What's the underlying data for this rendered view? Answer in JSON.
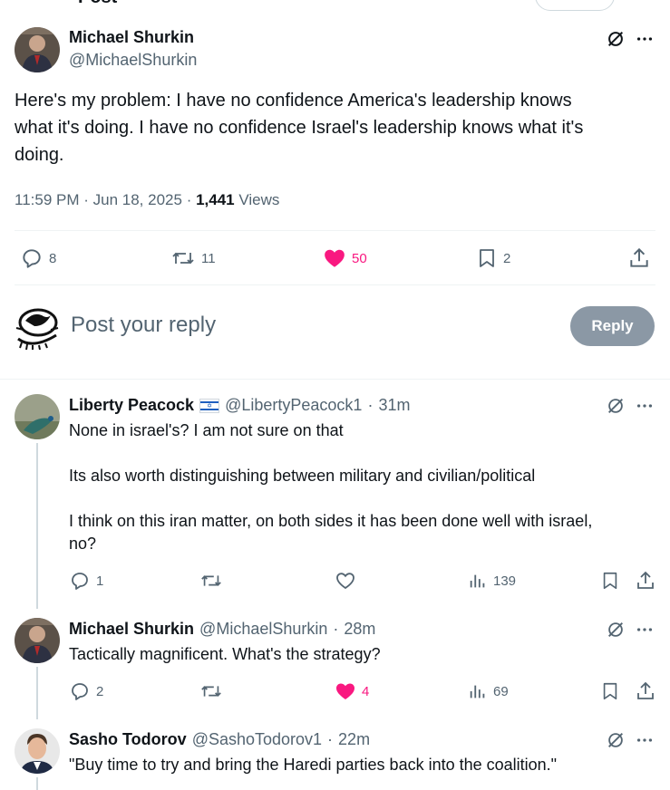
{
  "header": {
    "title": "Post",
    "reply_pill_label": "Reply"
  },
  "main_post": {
    "author_name": "Michael Shurkin",
    "author_handle": "@MichaelShurkin",
    "text_line1": "Here's my problem: I have no confidence America's leadership knows",
    "text_line2": "what it's doing. I have no confidence Israel's leadership knows what it's",
    "text_line3": "doing.",
    "time": "11:59 PM",
    "date": "Jun 18, 2025",
    "views_count": "1,441",
    "views_label": "Views",
    "replies": "8",
    "reposts": "11",
    "likes": "50",
    "bookmarks": "2"
  },
  "composer": {
    "placeholder": "Post your reply",
    "button_label": "Reply"
  },
  "replies": [
    {
      "author_name": "Liberty Peacock",
      "author_handle": "@LibertyPeacock1",
      "time": "31m",
      "text_1": "None in israel's? I am not sure on that",
      "text_2": "Its also worth distinguishing between military and civilian/political",
      "text_3": "I think on this iran matter, on both sides it has been done well with israel,",
      "text_4": "no?",
      "replies": "1",
      "reposts": "",
      "likes": "",
      "views": "139"
    },
    {
      "author_name": "Michael Shurkin",
      "author_handle": "@MichaelShurkin",
      "time": "28m",
      "text_1": "Tactically magnificent. What's the strategy?",
      "replies": "2",
      "reposts": "",
      "likes": "4",
      "views": "69"
    },
    {
      "author_name": "Sasho Todorov",
      "author_handle": "@SashoTodorov1",
      "time": "22m",
      "text_1": "\"Buy time to try and bring the Haredi parties back into the coalition.\""
    }
  ],
  "colors": {
    "like_pink": "#f91880",
    "muted": "#536471",
    "reply_button_disabled": "#8b98a5"
  }
}
